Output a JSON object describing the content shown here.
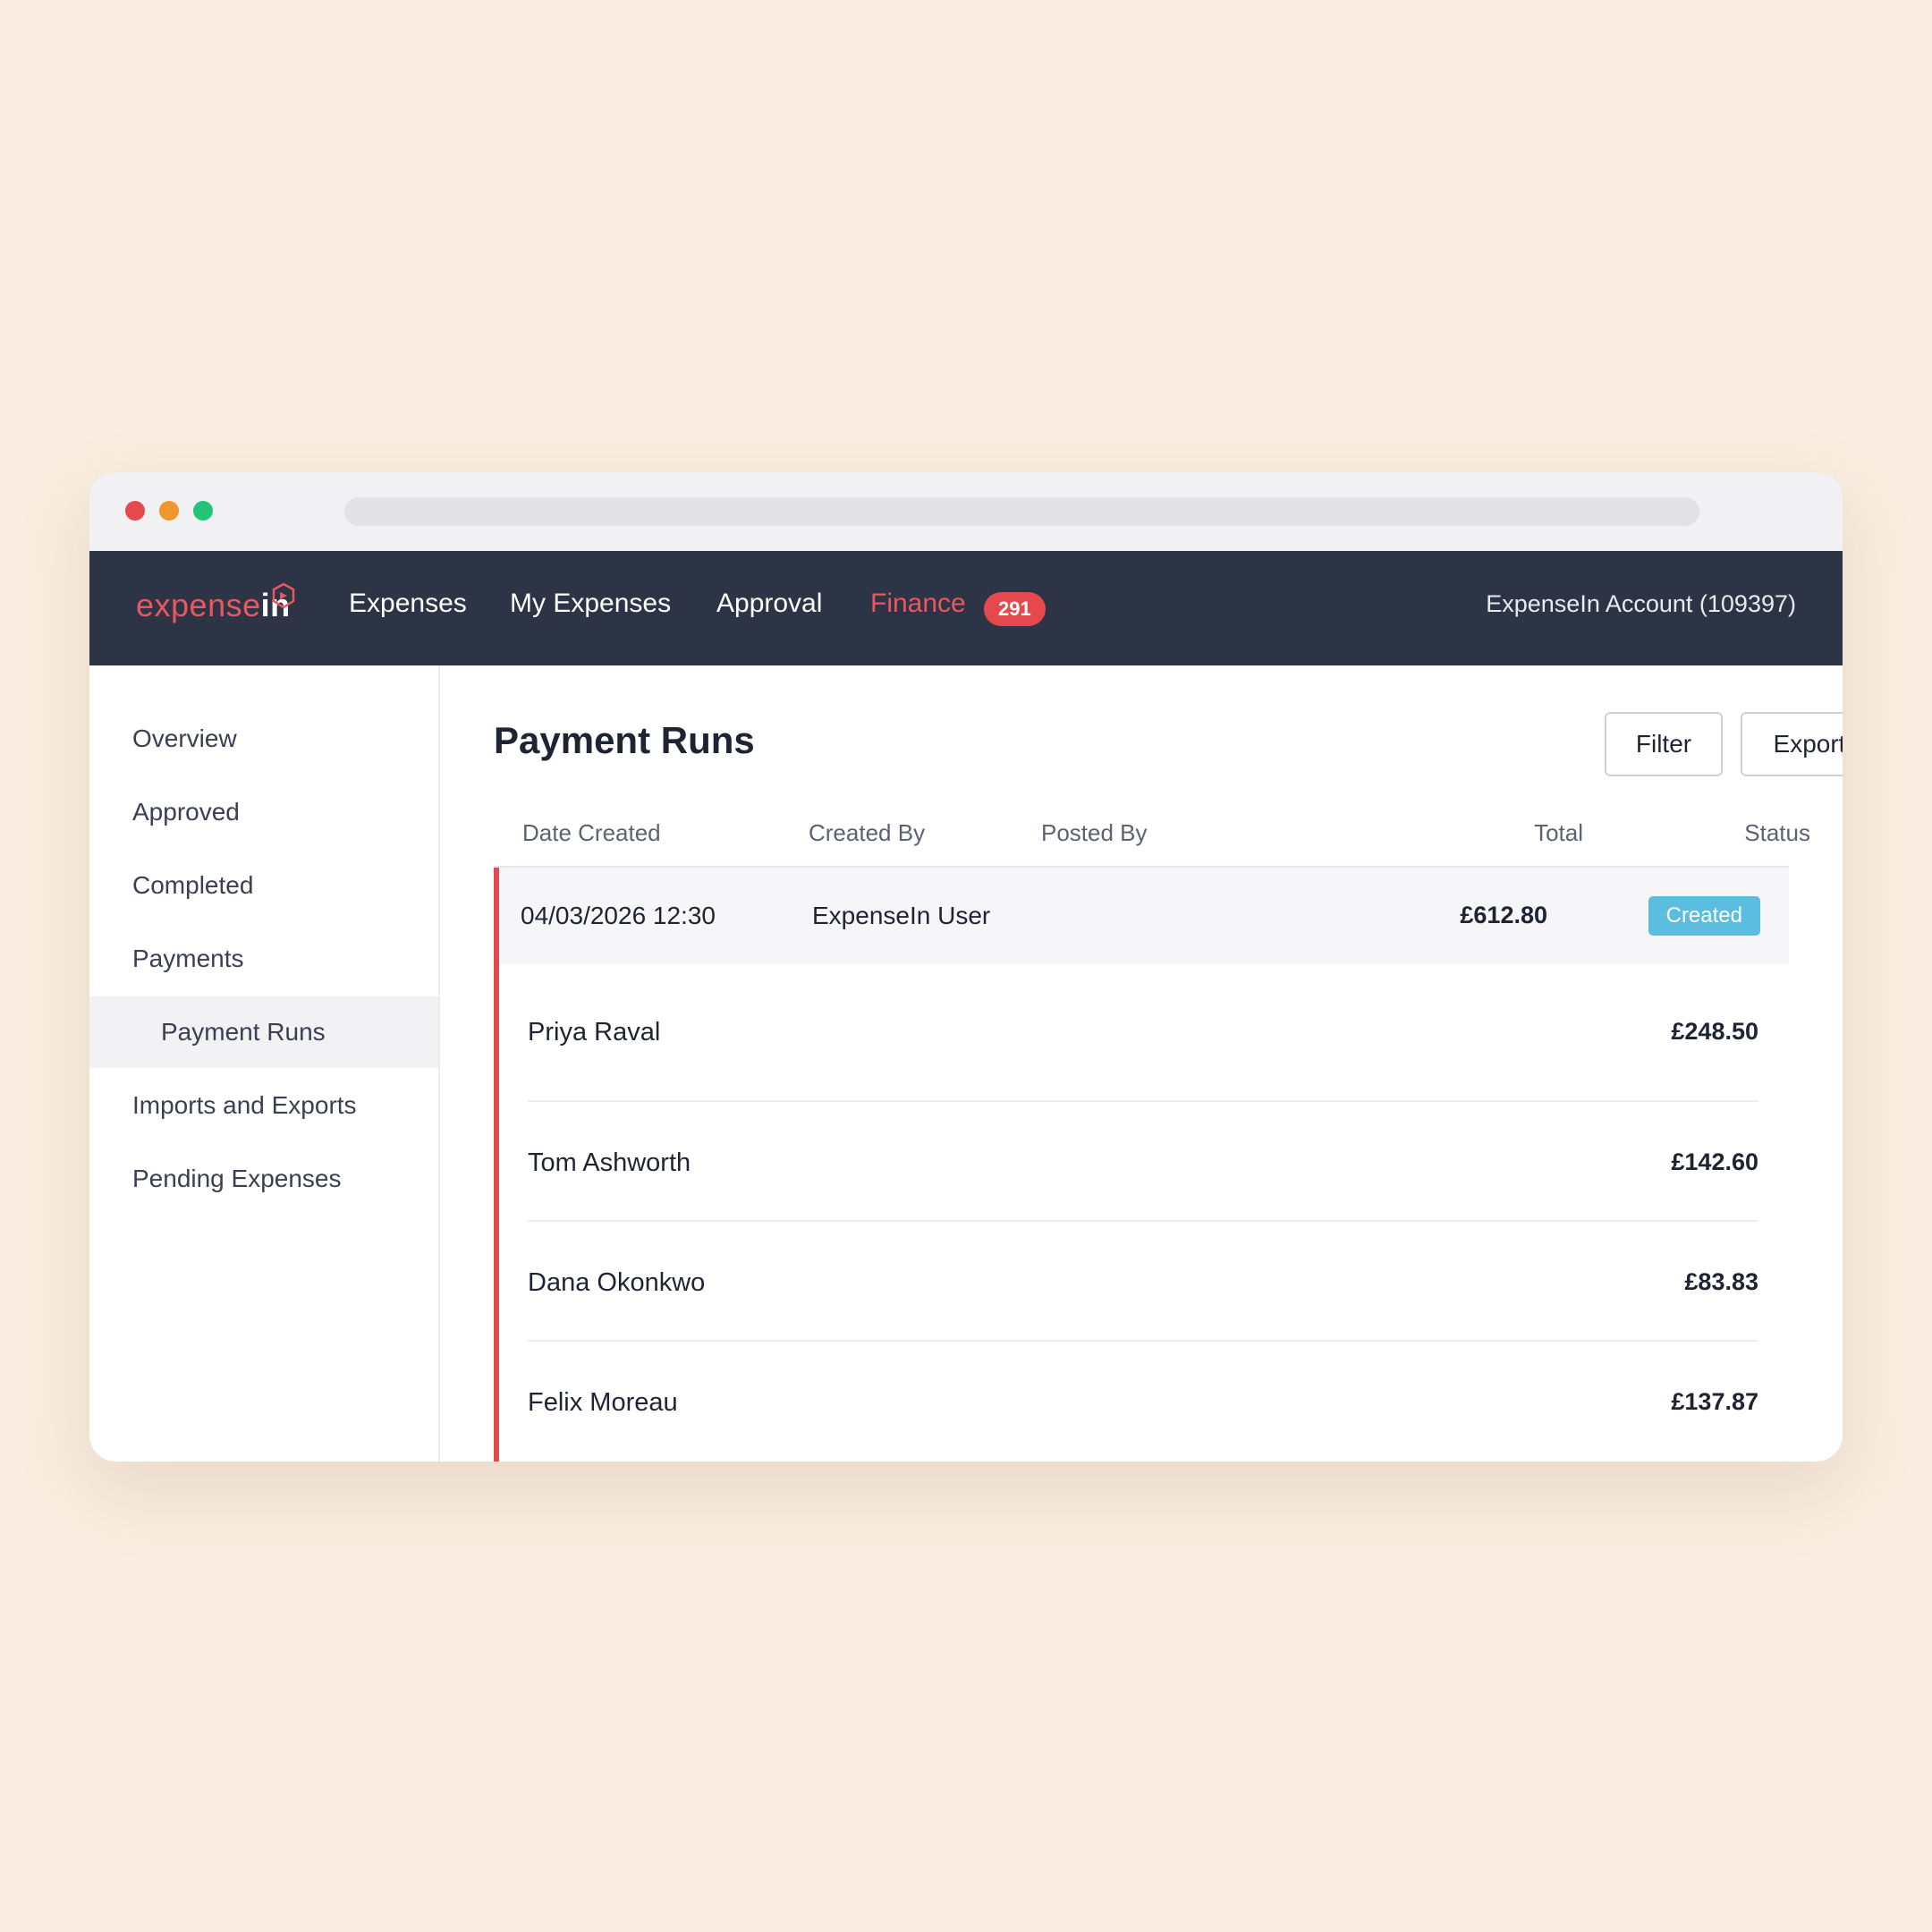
{
  "brand": {
    "logo_part1": "expense",
    "logo_part2": "in"
  },
  "nav": {
    "items": [
      {
        "label": "Expenses"
      },
      {
        "label": "My Expenses"
      },
      {
        "label": "Approval"
      },
      {
        "label": "Finance",
        "badge": "291"
      }
    ],
    "account": "ExpenseIn Account (109397)"
  },
  "sidebar": {
    "items": [
      {
        "label": "Overview"
      },
      {
        "label": "Approved"
      },
      {
        "label": "Completed"
      },
      {
        "label": "Payments"
      },
      {
        "label": "Payment Runs"
      },
      {
        "label": "Imports and Exports"
      },
      {
        "label": "Pending Expenses"
      }
    ]
  },
  "main": {
    "title": "Payment Runs",
    "filter_label": "Filter",
    "export_label": "Export",
    "columns": [
      "Date Created",
      "Created By",
      "Posted By",
      "Total",
      "Status"
    ],
    "run": {
      "date_created": "04/03/2026 12:30",
      "created_by": "ExpenseIn User",
      "posted_by": "",
      "total": "£612.80",
      "status": "Created"
    },
    "payments": [
      {
        "name": "Priya Raval",
        "amount": "£248.50"
      },
      {
        "name": "Tom Ashworth",
        "amount": "£142.60"
      },
      {
        "name": "Dana Okonkwo",
        "amount": "£83.83"
      },
      {
        "name": "Felix Moreau",
        "amount": "£137.87"
      }
    ]
  },
  "colors": {
    "accent": "#e5484d",
    "nav_bg": "#2c3446",
    "status_created": "#5bbde0",
    "page_bg": "#f8ede0"
  }
}
